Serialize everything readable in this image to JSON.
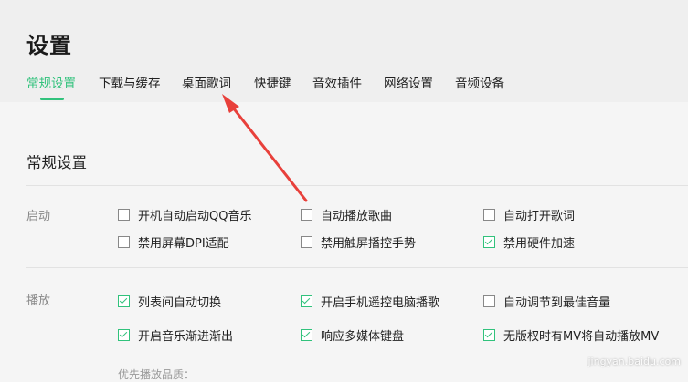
{
  "window": {
    "title": "设置"
  },
  "tabs": [
    {
      "label": "常规设置",
      "active": true
    },
    {
      "label": "下载与缓存",
      "active": false
    },
    {
      "label": "桌面歌词",
      "active": false
    },
    {
      "label": "快捷键",
      "active": false
    },
    {
      "label": "音效插件",
      "active": false
    },
    {
      "label": "网络设置",
      "active": false
    },
    {
      "label": "音频设备",
      "active": false
    }
  ],
  "section": {
    "title": "常规设置"
  },
  "groups": {
    "startup": {
      "label": "启动",
      "options": [
        {
          "label": "开机自动启动QQ音乐",
          "checked": false
        },
        {
          "label": "自动播放歌曲",
          "checked": false
        },
        {
          "label": "自动打开歌词",
          "checked": false
        },
        {
          "label": "禁用屏幕DPI适配",
          "checked": false
        },
        {
          "label": "禁用触屏播控手势",
          "checked": false
        },
        {
          "label": "禁用硬件加速",
          "checked": true
        }
      ]
    },
    "playback": {
      "label": "播放",
      "options": [
        {
          "label": "列表间自动切换",
          "checked": true
        },
        {
          "label": "开启手机遥控电脑播歌",
          "checked": true
        },
        {
          "label": "自动调节到最佳音量",
          "checked": false
        },
        {
          "label": "开启音乐渐进渐出",
          "checked": true
        },
        {
          "label": "响应多媒体键盘",
          "checked": true
        },
        {
          "label": "无版权时有MV将自动播放MV",
          "checked": true
        }
      ],
      "quality_label": "优先播放品质："
    }
  },
  "watermark": "jingyan.baidu.com",
  "colors": {
    "accent": "#31c27c",
    "annotation_arrow": "#e8403b"
  }
}
